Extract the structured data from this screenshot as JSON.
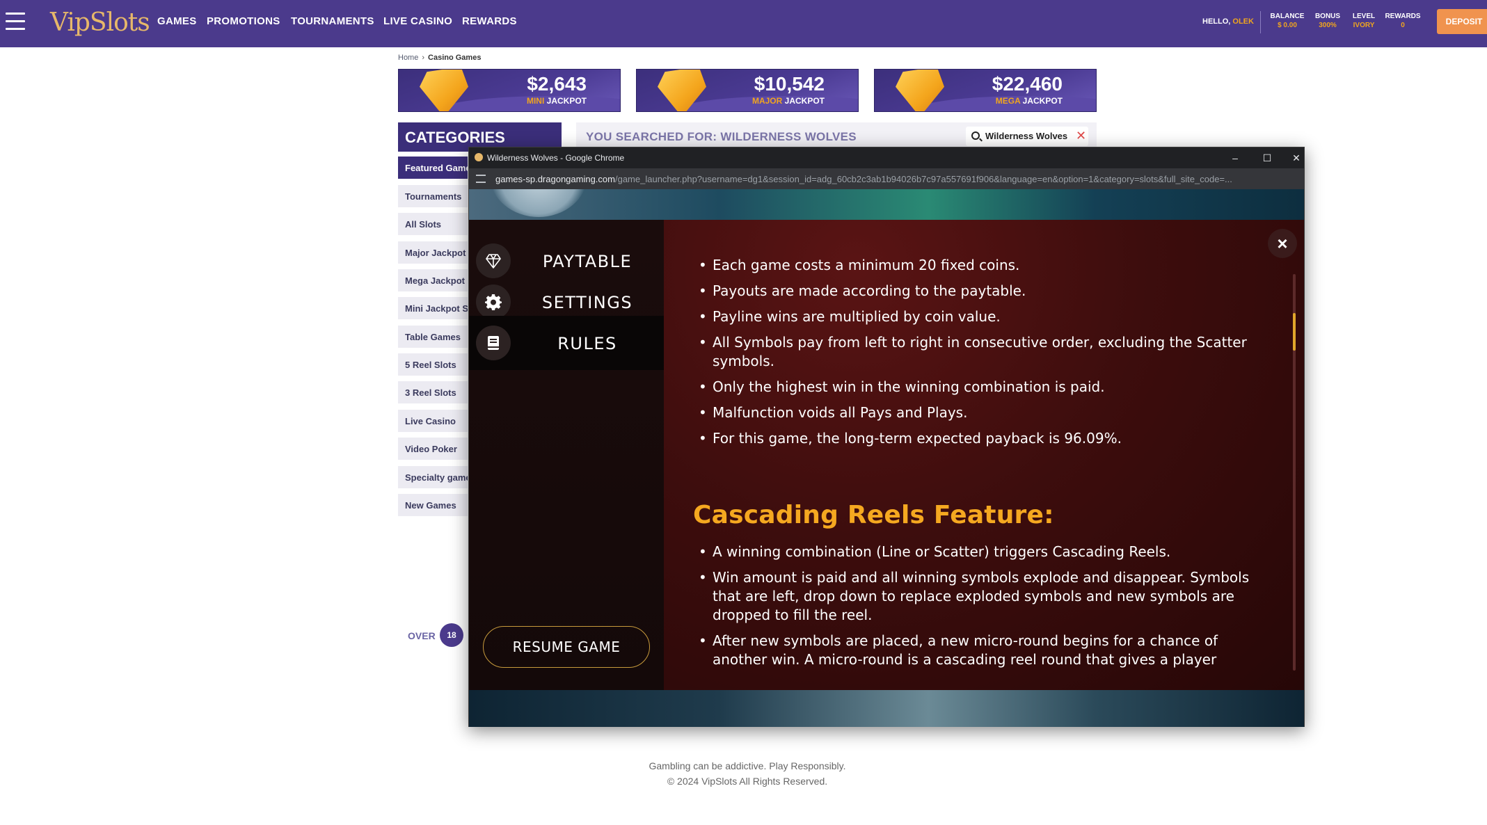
{
  "site": {
    "logo": "VipSlots",
    "nav": [
      "GAMES",
      "PROMOTIONS",
      "TOURNAMENTS",
      "LIVE CASINO",
      "REWARDS"
    ],
    "hello_prefix": "HELLO,",
    "username": "OLEK",
    "stats": [
      {
        "label": "BALANCE",
        "value": "$ 0.00"
      },
      {
        "label": "BONUS",
        "value": "300%"
      },
      {
        "label": "LEVEL",
        "value": "IVORY"
      },
      {
        "label": "REWARDS",
        "value": "0"
      }
    ],
    "deposit_label": "DEPOSIT",
    "accent_color": "#f0a51e",
    "nav_color": "#4b3a8c"
  },
  "breadcrumb": {
    "home": "Home",
    "current": "Casino Games"
  },
  "jackpots": [
    {
      "amount": "$2,643",
      "kind": "MINI",
      "suffix": "JACKPOT"
    },
    {
      "amount": "$10,542",
      "kind": "MAJOR",
      "suffix": "JACKPOT"
    },
    {
      "amount": "$22,460",
      "kind": "MEGA",
      "suffix": "JACKPOT"
    }
  ],
  "categories": {
    "title": "CATEGORIES",
    "items": [
      "Featured Games",
      "Tournaments",
      "All Slots",
      "Major Jackpot Slots",
      "Mega Jackpot Slots",
      "Mini Jackpot Slots",
      "Table Games",
      "5 Reel Slots",
      "3 Reel Slots",
      "Live Casino",
      "Video Poker",
      "Specialty games",
      "New Games"
    ]
  },
  "search": {
    "label": "YOU SEARCHED FOR: WILDERNESS WOLVES",
    "value": "Wilderness Wolves"
  },
  "over_label": "OVER",
  "over_count": "18",
  "footer": {
    "line1": "Gambling can be addictive. Play Responsibly.",
    "line2": "© 2024 VipSlots All Rights Reserved."
  },
  "popup": {
    "title": "Wilderness Wolves - Google Chrome",
    "url_host": "games-sp.dragongaming.com",
    "url_path": "/game_launcher.php?username=dg1&session_id=adg_60cb2c3ab1b94026b7c97a557691f906&language=en&option=1&category=slots&full_site_code=...",
    "controls": {
      "minimize": "–",
      "maximize": "☐",
      "close": "✕"
    }
  },
  "game_menu": {
    "items": [
      {
        "label": "PAYTABLE",
        "icon": "diamond-icon"
      },
      {
        "label": "SETTINGS",
        "icon": "gear-icon"
      },
      {
        "label": "RULES",
        "icon": "book-icon"
      }
    ],
    "active": "RULES",
    "resume_label": "RESUME GAME",
    "close_glyph": "×"
  },
  "rules": {
    "general": [
      "Each game costs a minimum 20 fixed coins.",
      "Payouts are made according to the paytable.",
      "Payline wins are multiplied by coin value.",
      "All Symbols pay from left to right in consecutive order, excluding the Scatter symbols.",
      "Only the highest win in the winning combination is paid.",
      "Malfunction voids all Pays and Plays.",
      "For this game, the long-term expected payback is 96.09%."
    ],
    "cascade_title": "Cascading Reels Feature:",
    "cascade": [
      "A winning combination (Line or Scatter) triggers Cascading Reels.",
      "Win amount is paid and all winning symbols explode and disappear. Symbols that are left, drop down to replace exploded symbols and new symbols are dropped to fill the reel.",
      "After new symbols are placed, a new micro-round begins for a chance of another win. A micro-round is a cascading reel round that gives a player"
    ]
  }
}
